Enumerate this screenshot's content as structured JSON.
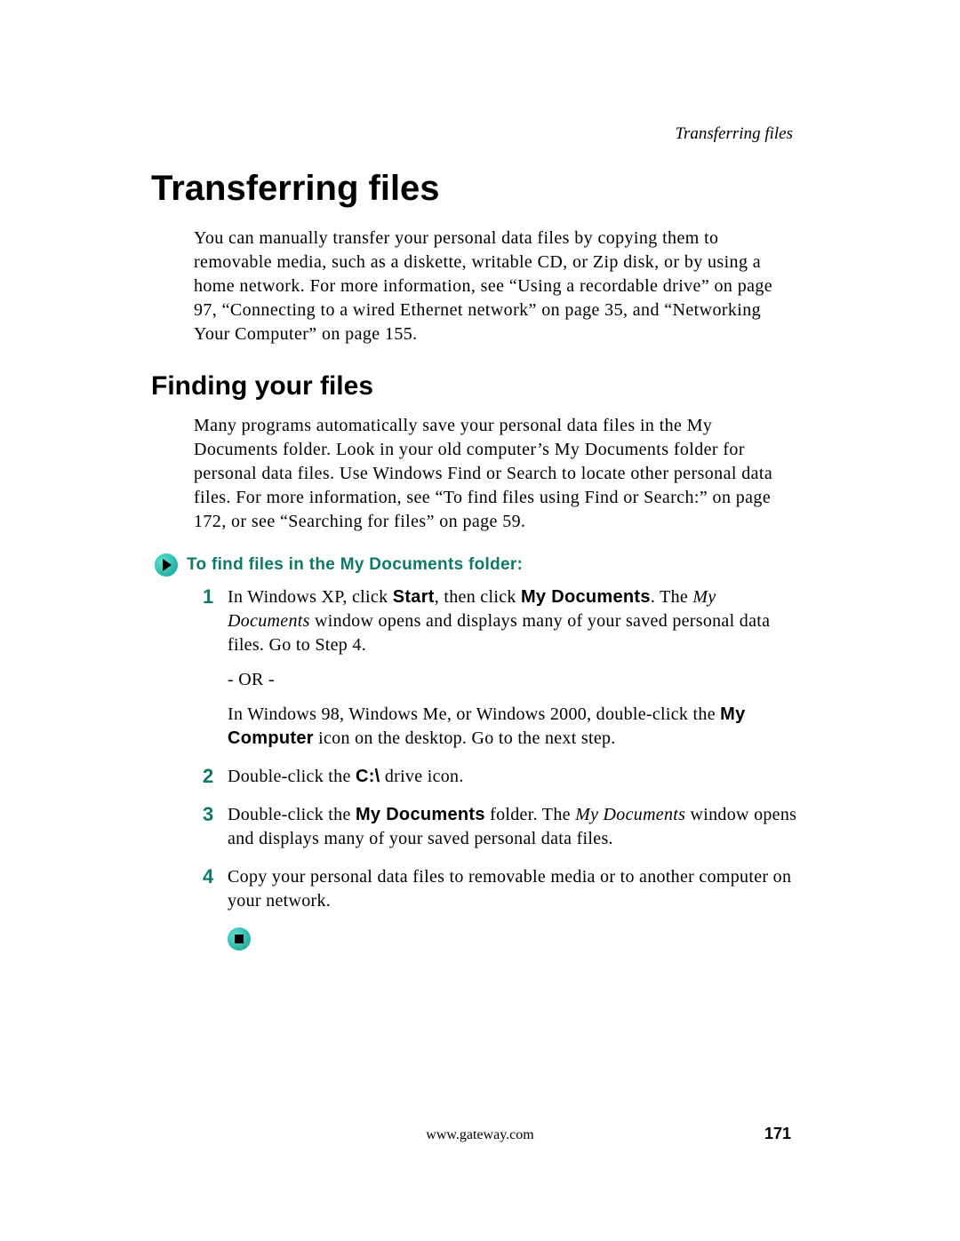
{
  "header": {
    "running_title": "Transferring files"
  },
  "h1": "Transferring files",
  "p1": "You can manually transfer your personal data files by copying them to removable media, such as a diskette, writable CD, or Zip disk, or by using a home network. For more information, see “Using a recordable drive” on page 97, “Connecting to a wired Ethernet network” on page 35, and “Networking Your Computer” on page 155.",
  "h2": "Finding your files",
  "p2": "Many programs automatically save your personal data files in the My Documents folder. Look in your old computer’s My Documents folder for personal data files. Use Windows Find or Search to locate other personal data files. For more information, see “To find files using Find or Search:” on page 172, or see “Searching for files” on page 59.",
  "procedure": {
    "title": "To find files in the My Documents folder:"
  },
  "steps": {
    "s1": {
      "num": "1",
      "a1": "In Windows XP, click ",
      "b1": "Start",
      "a2": ", then click ",
      "b2": "My Documents",
      "a3": ". The ",
      "i1": "My Documents",
      "a4": " window opens and displays many of your saved personal data files. Go to Step 4.",
      "or": "- OR -",
      "c1": "In Windows 98, Windows Me, or Windows 2000, double-click the ",
      "b3": "My Computer",
      "c2": " icon on the desktop. Go to the next step."
    },
    "s2": {
      "num": "2",
      "a1": "Double-click the ",
      "b1": "C:\\",
      "a2": " drive icon."
    },
    "s3": {
      "num": "3",
      "a1": "Double-click the ",
      "b1": "My Documents",
      "a2": " folder. The ",
      "i1": "My Documents",
      "a3": " window opens and displays many of your saved personal data files."
    },
    "s4": {
      "num": "4",
      "a1": "Copy your personal data files to removable media or to another computer on your network."
    }
  },
  "footer": {
    "url": "www.gateway.com",
    "page": "171"
  }
}
